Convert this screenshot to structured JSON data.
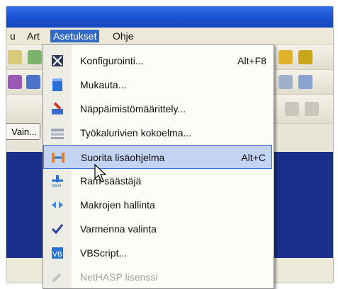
{
  "menubar": {
    "items": [
      {
        "label": "u"
      },
      {
        "label": "Art"
      },
      {
        "label": "Asetukset"
      },
      {
        "label": "Ohje"
      }
    ]
  },
  "toolbar": {
    "small_button_label": "Vain..."
  },
  "dropdown": {
    "items": [
      {
        "label": "Konfigurointi...",
        "shortcut": "Alt+F8",
        "icon": "configure-icon"
      },
      {
        "label": "Mukauta...",
        "shortcut": "",
        "icon": "customize-icon"
      },
      {
        "label": "Näppäimistömäärittely...",
        "shortcut": "",
        "icon": "keyboard-mapping-icon"
      },
      {
        "label": "Työkalurivien kokoelma...",
        "shortcut": "",
        "icon": "toolbar-collection-icon"
      },
      {
        "label": "Suorita lisäohjelma",
        "shortcut": "Alt+C",
        "icon": "run-addin-icon"
      },
      {
        "label": "Ram-säästäjä",
        "shortcut": "",
        "icon": "ram-saver-icon"
      },
      {
        "label": "Makrojen hallinta",
        "shortcut": "",
        "icon": "macro-manager-icon"
      },
      {
        "label": "Varmenna valinta",
        "shortcut": "",
        "icon": "verify-selection-icon"
      },
      {
        "label": "VBScript...",
        "shortcut": "",
        "icon": "vbscript-icon"
      },
      {
        "label": "NetHASP lisenssi",
        "shortcut": "",
        "icon": "nethasp-license-icon"
      }
    ]
  },
  "colors": {
    "menu_active": "#316ac5",
    "selection_bg": "#c2d3f3",
    "selection_border": "#3a6fd3",
    "title_blue": "#2f6fe8",
    "dark_background": "#1a2f8c"
  }
}
